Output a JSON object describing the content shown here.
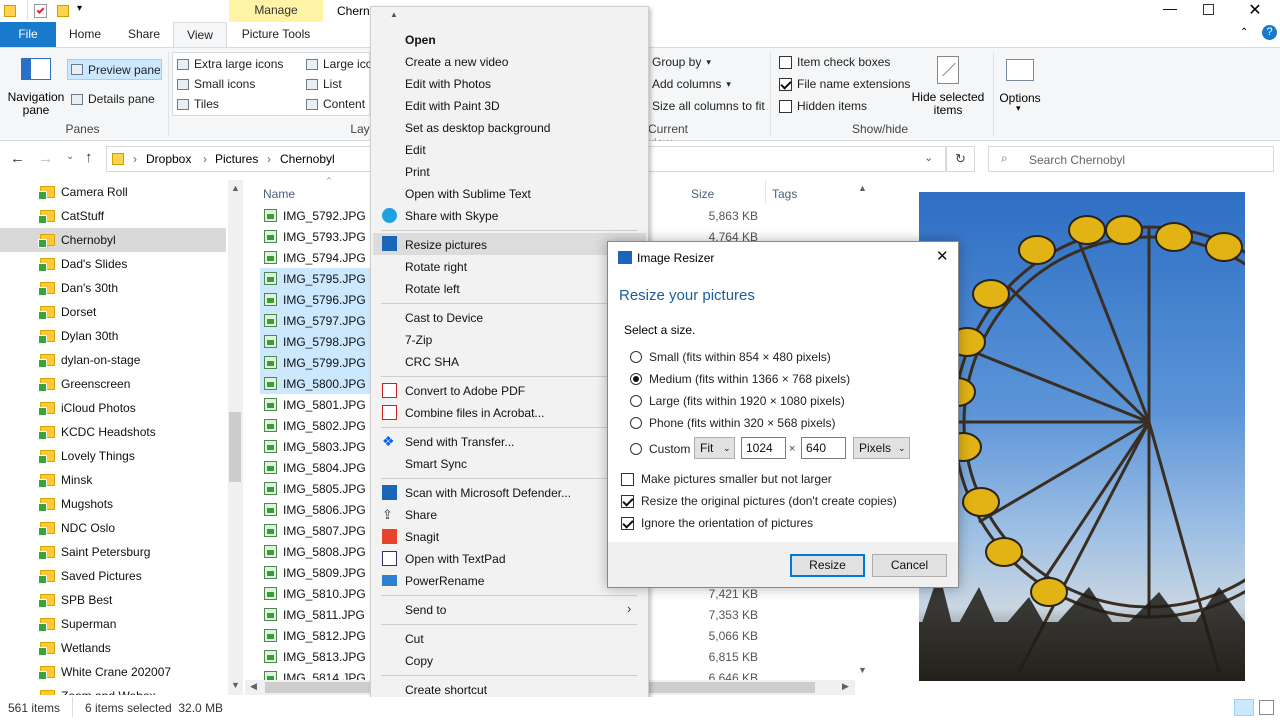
{
  "window": {
    "title": "Chern",
    "manage_tab": "Manage",
    "picture_tools": "Picture Tools"
  },
  "ribbon_tabs": {
    "file": "File",
    "home": "Home",
    "share": "Share",
    "view": "View"
  },
  "ribbon": {
    "navigation_pane": "Navigation\npane",
    "preview_pane": "Preview pane",
    "details_pane": "Details pane",
    "panes_group": "Panes",
    "extra_large_icons": "Extra large icons",
    "small_icons": "Small icons",
    "tiles": "Tiles",
    "large_icons": "Large ico",
    "list": "List",
    "content": "Content",
    "layout_group": "Lay",
    "group_by": "Group by",
    "add_columns": "Add columns",
    "size_all_columns": "Size all columns to fit",
    "current_view_group": "Current view",
    "item_check_boxes": "Item check boxes",
    "file_name_extensions": "File name extensions",
    "hidden_items": "Hidden items",
    "hide_selected_items": "Hide selected\nitems",
    "show_hide_group": "Show/hide",
    "options": "Options"
  },
  "address": {
    "crumbs": [
      "Dropbox",
      "Pictures",
      "Chernobyl"
    ],
    "search_placeholder": "Search Chernobyl"
  },
  "nav_items": [
    "Camera Roll",
    "CatStuff",
    "Chernobyl",
    "Dad's Slides",
    "Dan's 30th",
    "Dorset",
    "Dylan 30th",
    "dylan-on-stage",
    "Greenscreen",
    "iCloud Photos",
    "KCDC Headshots",
    "Lovely Things",
    "Minsk",
    "Mugshots",
    "NDC Oslo",
    "Saint Petersburg",
    "Saved Pictures",
    "SPB Best",
    "Superman",
    "Wetlands",
    "White Crane 202007",
    "Zoom and Webex"
  ],
  "columns": {
    "name": "Name",
    "size": "Size",
    "tags": "Tags"
  },
  "files": [
    "IMG_5792.JPG",
    "IMG_5793.JPG",
    "IMG_5794.JPG",
    "IMG_5795.JPG",
    "IMG_5796.JPG",
    "IMG_5797.JPG",
    "IMG_5798.JPG",
    "IMG_5799.JPG",
    "IMG_5800.JPG",
    "IMG_5801.JPG",
    "IMG_5802.JPG",
    "IMG_5803.JPG",
    "IMG_5804.JPG",
    "IMG_5805.JPG",
    "IMG_5806.JPG",
    "IMG_5807.JPG",
    "IMG_5808.JPG",
    "IMG_5809.JPG",
    "IMG_5810.JPG",
    "IMG_5811.JPG",
    "IMG_5812.JPG",
    "IMG_5813.JPG",
    "IMG_5814.JPG"
  ],
  "selected_files": [
    3,
    4,
    5,
    6,
    7,
    8
  ],
  "sizes": [
    {
      "row": 0,
      "text": "5,863 KB"
    },
    {
      "row": 1,
      "text": "4,764 KB"
    },
    {
      "row": 18,
      "text": "7,421 KB"
    },
    {
      "row": 19,
      "text": "7,353 KB"
    },
    {
      "row": 20,
      "text": "5,066 KB"
    },
    {
      "row": 21,
      "text": "6,815 KB"
    },
    {
      "row": 22,
      "text": "6,646 KB"
    }
  ],
  "context_menu": {
    "open": "Open",
    "create_video": "Create a new video",
    "edit_photos": "Edit with Photos",
    "edit_paint3d": "Edit with Paint 3D",
    "desktop_bg": "Set as desktop background",
    "edit": "Edit",
    "print": "Print",
    "open_sublime": "Open with Sublime Text",
    "share_skype": "Share with Skype",
    "resize_pictures": "Resize pictures",
    "rotate_right": "Rotate right",
    "rotate_left": "Rotate left",
    "cast": "Cast to Device",
    "zip": "7-Zip",
    "crc": "CRC SHA",
    "convert_pdf": "Convert to Adobe PDF",
    "combine_acrobat": "Combine files in Acrobat...",
    "send_transfer": "Send with Transfer...",
    "smart_sync": "Smart Sync",
    "scan_defender": "Scan with Microsoft Defender...",
    "share": "Share",
    "snagit": "Snagit",
    "open_textpad": "Open with TextPad",
    "powerrename": "PowerRename",
    "send_to": "Send to",
    "cut": "Cut",
    "copy": "Copy",
    "create_shortcut": "Create shortcut"
  },
  "dialog": {
    "title": "Image Resizer",
    "heading": "Resize your pictures",
    "select_size": "Select a size.",
    "small": "Small (fits within 854 × 480 pixels)",
    "medium": "Medium (fits within 1366 × 768 pixels)",
    "large": "Large (fits within 1920 × 1080 pixels)",
    "phone": "Phone (fits within 320 × 568 pixels)",
    "custom": "Custom",
    "fit": "Fit",
    "width": "1024",
    "times": "×",
    "height": "640",
    "unit": "Pixels",
    "smaller_not_larger": "Make pictures smaller but not larger",
    "resize_original": "Resize the original pictures (don't create copies)",
    "ignore_orientation": "Ignore the orientation of pictures",
    "resize_btn": "Resize",
    "cancel_btn": "Cancel"
  },
  "status": {
    "items": "561 items",
    "selected": "6 items selected  32.0 MB"
  },
  "colors": {
    "file_tab": "#1979ca",
    "manage_tab": "#fff4a6",
    "selection": "#cce8ff",
    "dialog_heading": "#1b5d9c"
  }
}
